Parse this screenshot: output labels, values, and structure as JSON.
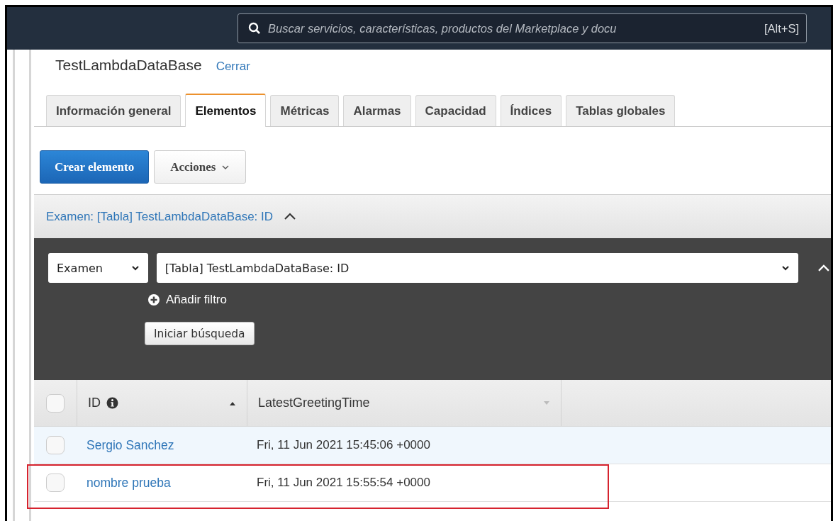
{
  "top_bar": {
    "search": {
      "placeholder": "Buscar servicios, características, productos del Marketplace y docu",
      "shortcut": "[Alt+S]"
    }
  },
  "table_name": "TestLambdaDataBase",
  "close_link": "Cerrar",
  "tabs": [
    {
      "label": "Información general",
      "selected": false
    },
    {
      "label": "Elementos",
      "selected": true
    },
    {
      "label": "Métricas",
      "selected": false
    },
    {
      "label": "Alarmas",
      "selected": false
    },
    {
      "label": "Capacidad",
      "selected": false
    },
    {
      "label": "Índices",
      "selected": false
    },
    {
      "label": "Tablas globales",
      "selected": false
    }
  ],
  "toolbar": {
    "create_button": "Crear elemento",
    "actions_button": "Acciones"
  },
  "query_panel": {
    "title": "Examen: [Tabla] TestLambdaDataBase: ID",
    "expanded": true,
    "mode": "Examen",
    "target": "[Tabla] TestLambdaDataBase: ID",
    "add_filter": "Añadir filtro",
    "start_button": "Iniciar búsqueda"
  },
  "table": {
    "select_all_checked": false,
    "columns": [
      {
        "label": "ID",
        "info": true,
        "sorted": true
      },
      {
        "label": "LatestGreetingTime",
        "info": false,
        "sorted": false
      }
    ],
    "rows": [
      {
        "checked": false,
        "highlighted": true,
        "annotated": false,
        "cells": [
          "Sergio Sanchez",
          "Fri, 11 Jun 2021 15:45:06 +0000"
        ]
      },
      {
        "checked": false,
        "highlighted": false,
        "annotated": true,
        "cells": [
          "nombre prueba",
          "Fri, 11 Jun 2021 15:55:54 +0000"
        ]
      }
    ]
  }
}
